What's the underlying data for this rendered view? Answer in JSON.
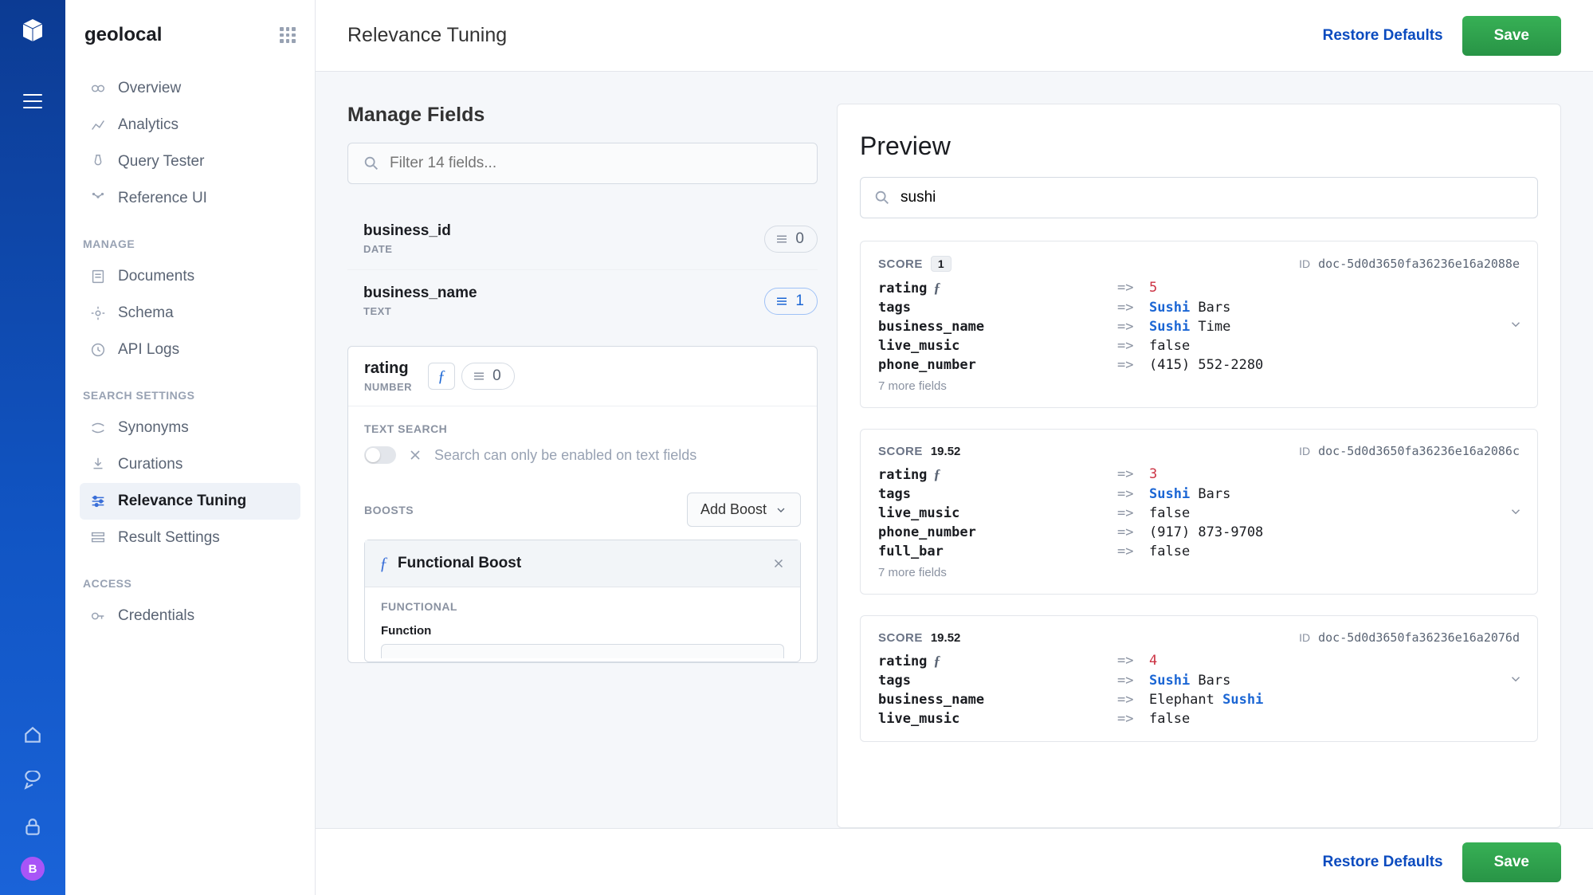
{
  "app_name": "geolocal",
  "page_title": "Relevance Tuning",
  "restore_label": "Restore Defaults",
  "save_label": "Save",
  "avatar_letter": "B",
  "sidebar": {
    "top": [
      {
        "label": "Overview"
      },
      {
        "label": "Analytics"
      },
      {
        "label": "Query Tester"
      },
      {
        "label": "Reference UI"
      }
    ],
    "heading_manage": "MANAGE",
    "manage": [
      {
        "label": "Documents"
      },
      {
        "label": "Schema"
      },
      {
        "label": "API Logs"
      }
    ],
    "heading_search": "SEARCH SETTINGS",
    "search": [
      {
        "label": "Synonyms"
      },
      {
        "label": "Curations"
      },
      {
        "label": "Relevance Tuning"
      },
      {
        "label": "Result Settings"
      }
    ],
    "heading_access": "ACCESS",
    "access": [
      {
        "label": "Credentials"
      }
    ]
  },
  "manage_fields": {
    "title": "Manage Fields",
    "filter_placeholder": "Filter 14 fields...",
    "fields": [
      {
        "name": "business_id",
        "type": "DATE",
        "count": "0"
      },
      {
        "name": "business_name",
        "type": "TEXT",
        "count": "1",
        "blue": true
      }
    ],
    "active": {
      "name": "rating",
      "type": "NUMBER",
      "count": "0",
      "text_search_label": "TEXT SEARCH",
      "text_search_hint": "Search can only be enabled on text fields",
      "boosts_label": "BOOSTS",
      "add_boost": "Add Boost",
      "boost_title": "Functional Boost",
      "functional_label": "FUNCTIONAL",
      "function_label": "Function"
    }
  },
  "preview": {
    "title": "Preview",
    "query": "sushi",
    "score_label": "SCORE",
    "id_label": "ID",
    "arrow": "=>",
    "results": [
      {
        "score": "1",
        "badge": true,
        "id": "doc-5d0d3650fa36236e16a2088e",
        "rows": [
          {
            "k": "rating",
            "fx": true,
            "v": "5",
            "num": true
          },
          {
            "k": "tags",
            "v_pre": "",
            "hl": "Sushi",
            "v_post": " Bars"
          },
          {
            "k": "business_name",
            "v_pre": "",
            "hl": "Sushi",
            "v_post": " Time"
          },
          {
            "k": "live_music",
            "v": "false"
          },
          {
            "k": "phone_number",
            "v": "(415) 552-2280"
          }
        ],
        "more": "7 more fields"
      },
      {
        "score": "19.52",
        "badge": false,
        "id": "doc-5d0d3650fa36236e16a2086c",
        "rows": [
          {
            "k": "rating",
            "fx": true,
            "v": "3",
            "num": true
          },
          {
            "k": "tags",
            "v_pre": "",
            "hl": "Sushi",
            "v_post": " Bars"
          },
          {
            "k": "live_music",
            "v": "false"
          },
          {
            "k": "phone_number",
            "v": "(917) 873-9708"
          },
          {
            "k": "full_bar",
            "v": "false"
          }
        ],
        "more": "7 more fields"
      },
      {
        "score": "19.52",
        "badge": false,
        "id": "doc-5d0d3650fa36236e16a2076d",
        "rows": [
          {
            "k": "rating",
            "fx": true,
            "v": "4",
            "num": true
          },
          {
            "k": "tags",
            "v_pre": "",
            "hl": "Sushi",
            "v_post": " Bars"
          },
          {
            "k": "business_name",
            "v_pre": "Elephant ",
            "hl": "Sushi",
            "v_post": ""
          },
          {
            "k": "live_music",
            "v": "false"
          }
        ],
        "more": ""
      }
    ]
  }
}
